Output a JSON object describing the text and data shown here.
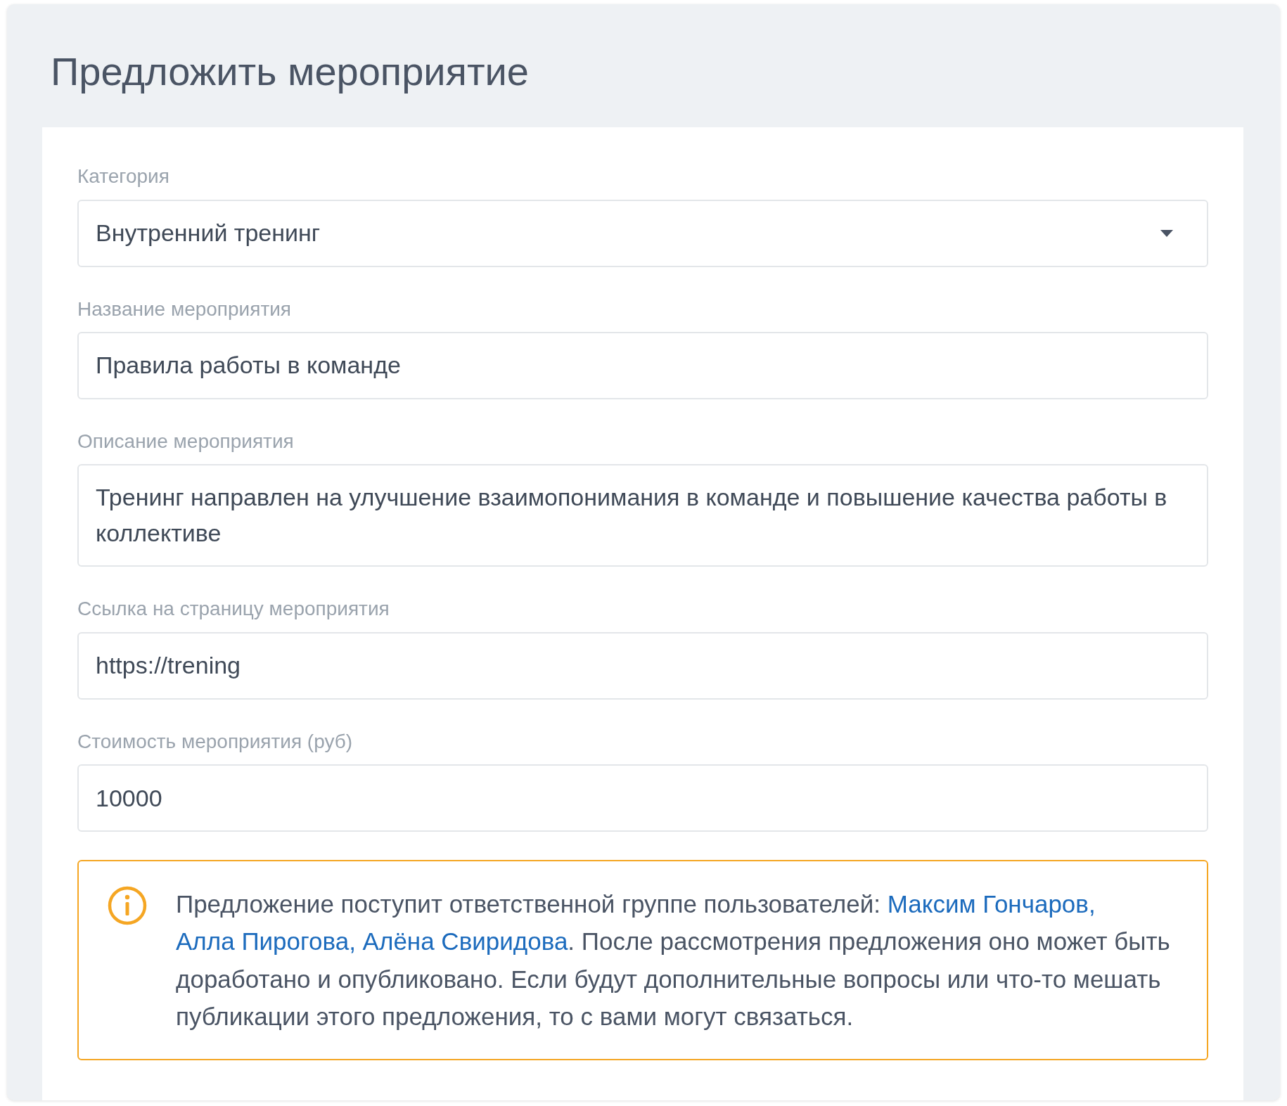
{
  "title": "Предложить мероприятие",
  "fields": [
    {
      "kind": "select",
      "label": "Категория",
      "value": "Внутренний тренинг"
    },
    {
      "kind": "text",
      "label": "Название мероприятия",
      "value": "Правила работы в команде"
    },
    {
      "kind": "textarea",
      "label": "Описание мероприятия",
      "value": "Тренинг направлен на улучшение взаимопонимания в команде и повышение качества работы в коллективе"
    },
    {
      "kind": "text",
      "label": "Ссылка на страницу мероприятия",
      "value": "https://trening"
    },
    {
      "kind": "text",
      "label": "Стоимость мероприятия (руб)",
      "value": "10000"
    }
  ],
  "notice": {
    "parts": [
      {
        "kind": "text",
        "text": "Предложение поступит ответственной группе пользователей: "
      },
      {
        "kind": "link",
        "text": "Максим Гончаров,"
      },
      {
        "kind": "link",
        "text": "Алла Пирогова,"
      },
      {
        "kind": "link",
        "text": "Алёна Свиридова"
      },
      {
        "kind": "text",
        "text": ". После рассмотрения предложения оно может быть доработано и опубликовано. Если будут дополнительные вопросы или что-то мешать публикации этого предложения, то с вами могут связаться."
      }
    ]
  }
}
